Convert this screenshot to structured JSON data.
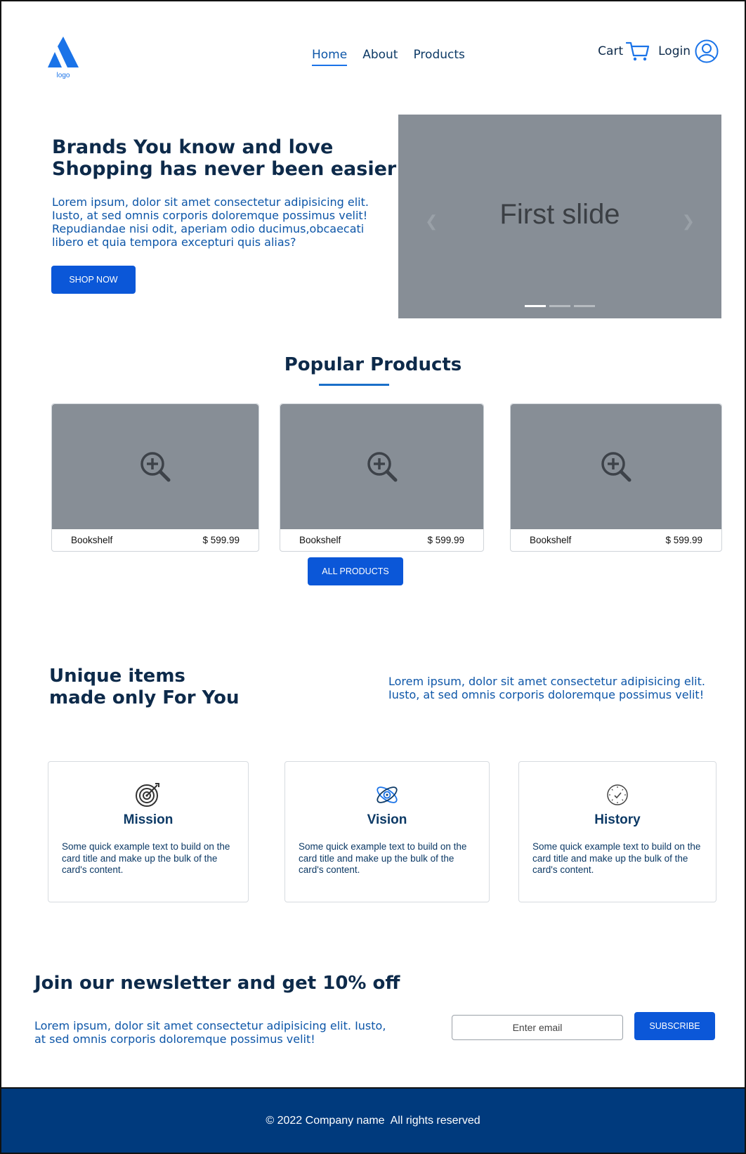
{
  "header": {
    "logo_text": "logo",
    "nav": [
      {
        "label": "Home",
        "active": true
      },
      {
        "label": "About",
        "active": false
      },
      {
        "label": "Products",
        "active": false
      }
    ],
    "cart_label": "Cart",
    "login_label": "Login",
    "accent_color": "#1a73e8"
  },
  "hero": {
    "title_line1": "Brands You know and love",
    "title_line2": "Shopping has never been easier",
    "text": "Lorem ipsum, dolor sit amet consectetur adipisicing elit. Iusto, at sed omnis corporis doloremque possimus velit! Repudiandae nisi odit, aperiam odio ducimus,obcaecati libero et quia tempora excepturi quis alias?",
    "button": "SHOP NOW"
  },
  "carousel": {
    "slide_label": "First slide",
    "prev_icon": "chevron-left-icon",
    "next_icon": "chevron-right-icon",
    "indicator_count": 3,
    "active_indicator": 0
  },
  "popular": {
    "title": "Popular Products",
    "products": [
      {
        "name": "Bookshelf",
        "price": "$ 599.99"
      },
      {
        "name": "Bookshelf",
        "price": "$ 599.99"
      },
      {
        "name": "Bookshelf",
        "price": "$ 599.99"
      }
    ],
    "button": "ALL PRODUCTS"
  },
  "unique": {
    "title_line1": "Unique items",
    "title_line2": "made only For You",
    "text": "Lorem ipsum, dolor sit amet consectetur adipisicing elit. Iusto, at sed omnis corporis doloremque possimus velit!",
    "cards": [
      {
        "icon": "target-icon",
        "title": "Mission",
        "text": "Some quick example text to build on the card title and make up the bulk of the card's content."
      },
      {
        "icon": "atom-icon",
        "title": "Vision",
        "text": "Some quick example text to build on the card title and make up the bulk of the card's content."
      },
      {
        "icon": "clock-icon",
        "title": "History",
        "text": "Some quick example text to build on the card title and make up the bulk of the card's content."
      }
    ]
  },
  "newsletter": {
    "title": "Join our newsletter and get 10% off",
    "text": "Lorem ipsum, dolor sit amet consectetur adipisicing elit. Iusto, at sed omnis corporis doloremque possimus velit!",
    "email_placeholder": "Enter email",
    "button": "SUBSCRIBE"
  },
  "footer": {
    "text": "© 2022 Company name  All rights reserved"
  }
}
